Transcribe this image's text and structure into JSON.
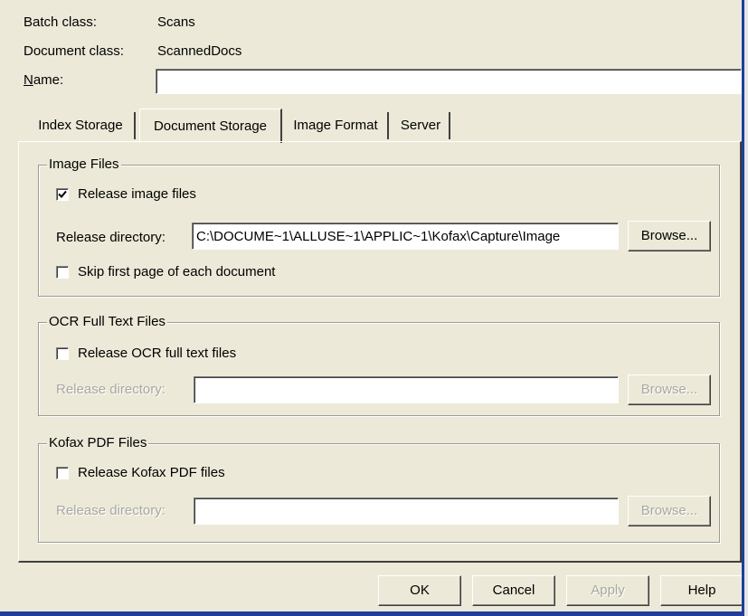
{
  "header": {
    "batch_class_label": "Batch class:",
    "batch_class_value": "Scans",
    "document_class_label": "Document class:",
    "document_class_value": "ScannedDocs",
    "name_label": "Name:",
    "name_value": ""
  },
  "tabs": [
    {
      "label": "Index Storage",
      "active": false
    },
    {
      "label": "Document Storage",
      "active": true
    },
    {
      "label": "Image Format",
      "active": false
    },
    {
      "label": "Server",
      "active": false
    }
  ],
  "image_files": {
    "title": "Image Files",
    "release_checkbox_label": "Release image files",
    "release_checked": true,
    "directory_label": "Release directory:",
    "directory_value": "C:\\DOCUME~1\\ALLUSE~1\\APPLIC~1\\Kofax\\Capture\\Image",
    "browse_label": "Browse...",
    "skip_label": "Skip first page of each document",
    "skip_checked": false
  },
  "ocr_files": {
    "title": "OCR Full Text Files",
    "release_checkbox_label": "Release OCR full text files",
    "release_checked": false,
    "directory_label": "Release directory:",
    "directory_value": "",
    "browse_label": "Browse..."
  },
  "pdf_files": {
    "title": "Kofax PDF Files",
    "release_checkbox_label": "Release Kofax PDF files",
    "release_checked": false,
    "directory_label": "Release directory:",
    "directory_value": "",
    "browse_label": "Browse..."
  },
  "footer": {
    "ok_label": "OK",
    "cancel_label": "Cancel",
    "apply_label": "Apply",
    "help_label": "Help"
  },
  "colors": {
    "dialog_background": "#ece9d8",
    "window_border": "#1f3f9a",
    "disabled_text": "#a8a8a0"
  },
  "icons": {
    "checkmark": "checkmark-icon"
  }
}
